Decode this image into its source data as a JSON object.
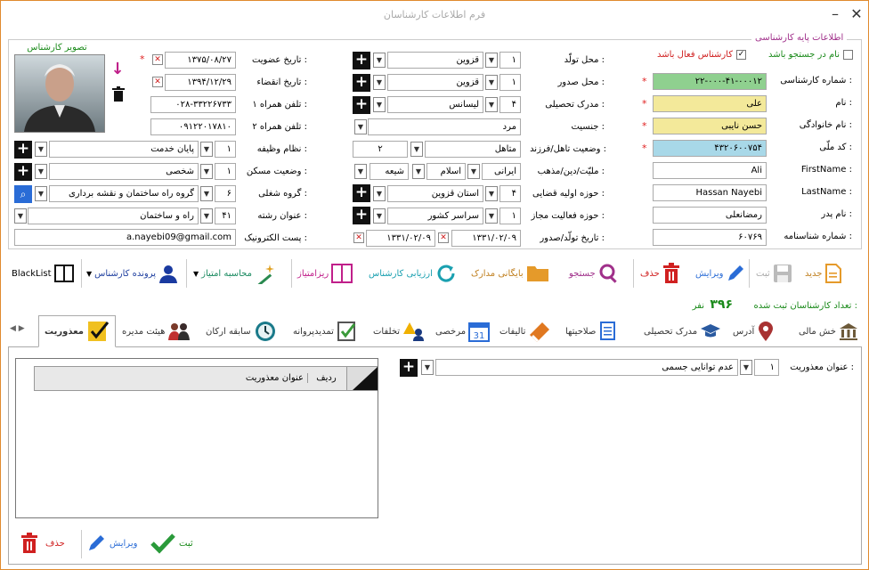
{
  "window": {
    "title": "فرم اطلاعات کارشناسان"
  },
  "section": {
    "legend": "اطلاعات پایه کارشناسی"
  },
  "checks": {
    "search_name": "نام در جستجو باشد",
    "active": "کارشناس فعال باشد"
  },
  "photo": {
    "label": "تصویر کارشناس"
  },
  "fields": {
    "expert_no": {
      "label": "شماره کارشناسی :",
      "value": "۲۲-۰۰۰-۴۱-۰۰۰۱۲"
    },
    "name": {
      "label": "نام :",
      "value": "علی"
    },
    "family": {
      "label": "نام خانوادگی :",
      "value": "حسن نایبی"
    },
    "national_code": {
      "label": "کد ملّی :",
      "value": "۴۳۲۰۶۰۰۷۵۴"
    },
    "firstname_en": {
      "label": "FirstName :",
      "value": "Ali"
    },
    "lastname_en": {
      "label": "LastName :",
      "value": "Hassan Nayebi"
    },
    "father": {
      "label": "نام پدر :",
      "value": "رمضانعلی"
    },
    "id_no": {
      "label": "شماره شناسنامه :",
      "value": "۶۰۷۶۹"
    },
    "birth_place": {
      "label": "محل تولّد :",
      "code": "۱",
      "value": "قزوین"
    },
    "issue_place": {
      "label": "محل صدور :",
      "code": "۱",
      "value": "قزوین"
    },
    "education": {
      "label": "مدرک تحصیلی :",
      "code": "۴",
      "value": "لیسانس"
    },
    "gender": {
      "label": "جنسیت :",
      "value": "مرد"
    },
    "marital": {
      "label": "وضعیت تاهل/فرزند :",
      "value": "متاهل",
      "children": "۲"
    },
    "nationality": {
      "label": "ملیّت/دین/مذهب :",
      "nation": "ایرانی",
      "religion": "اسلام",
      "sect": "شیعه"
    },
    "judicial": {
      "label": "حوزه اولیه قضایی :",
      "code": "۴",
      "value": "استان قزوین"
    },
    "activity": {
      "label": "حوزه فعالیت مجاز :",
      "code": "۱",
      "value": "سراسر کشور"
    },
    "birth_issue_date": {
      "label": "تاریخ تولّد/صدور :",
      "birth": "۱۳۳۱/۰۲/۰۹",
      "issue": "۱۳۳۱/۰۲/۰۹"
    },
    "membership_date": {
      "label": "تاریخ عضویت :",
      "value": "۱۳۷۵/۰۸/۲۷"
    },
    "expiry_date": {
      "label": "تاریخ انقضاء :",
      "value": "۱۳۹۴/۱۲/۲۹"
    },
    "phone1": {
      "label": "تلفن همراه ۱ :",
      "value": "۰۲۸-۳۳۲۲۶۷۳۳"
    },
    "phone2": {
      "label": "تلفن همراه ۲ :",
      "value": "۰۹۱۲۲۰۱۷۸۱۰"
    },
    "military": {
      "label": "نظام وظیفه :",
      "code": "۱",
      "value": "پایان خدمت"
    },
    "housing": {
      "label": "وضعیت مسکن :",
      "code": "۱",
      "value": "شخصی"
    },
    "job_group": {
      "label": "گروه شغلی :",
      "code": "۶",
      "value": "گروه راه ساختمان و نقشه برداری"
    },
    "field_title": {
      "label": "عنوان رشته :",
      "code": "۴۱",
      "value": "راه و ساختمان"
    },
    "email": {
      "label": "پست الکترونیک :",
      "value": "a.nayebi09@gmail.com"
    }
  },
  "toolbar": {
    "new": "جدید",
    "save": "ثبت",
    "edit": "ویرایش",
    "delete": "حذف",
    "search": "جستجو",
    "archive": "بایگانی مدارک",
    "evaluate": "ارزیابی کارشناس",
    "score_detail": "ریزامتیاز",
    "calc_score": "محاسبه امتیاز",
    "file": "پرونده کارشناس",
    "blacklist": "BlackList"
  },
  "count": {
    "label": "تعداد کارشناسان ثبت شده :",
    "value": "۳۹۶",
    "unit": "نفر"
  },
  "tabs": [
    "خش مالی",
    "آدرس",
    "مدرک تحصیلی",
    "صلاحیتها",
    "تالیفات",
    "مرخصی",
    "تخلفات",
    "تمدیدپروانه",
    "سابقه ارکان",
    "هیئت مدیره",
    "معذوریت"
  ],
  "excuse": {
    "label": "عنوان معذوریت :",
    "code": "۱",
    "value": "عدم توانایی جسمی"
  },
  "grid": {
    "col_row": "ردیف",
    "col_title": "عنوان معذوریت"
  },
  "bottom": {
    "save": "ثبت",
    "edit": "ویرایش",
    "delete": "حذف"
  }
}
